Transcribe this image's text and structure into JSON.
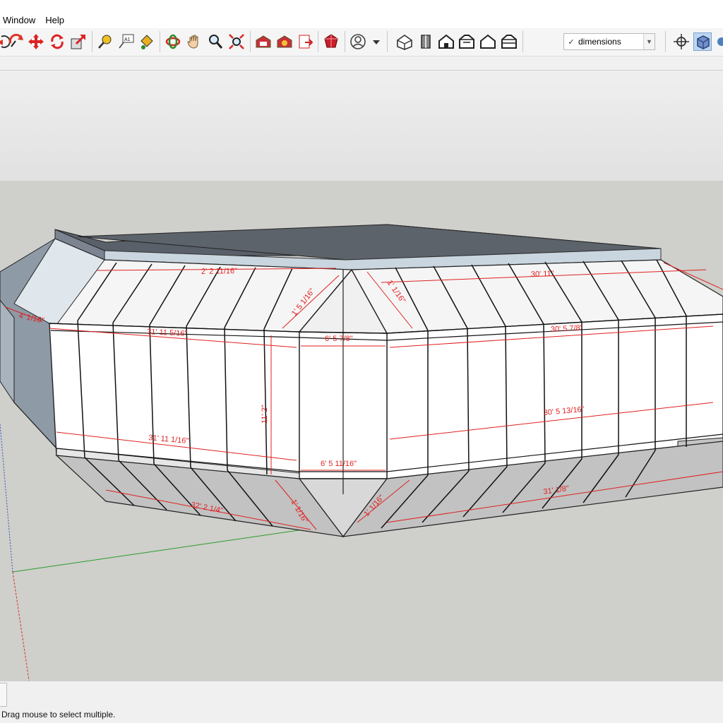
{
  "menu": {
    "items": [
      {
        "label": "Window"
      },
      {
        "label": "Help"
      }
    ]
  },
  "toolbar": {
    "icons": [
      "orbit-partial-icon",
      "rotate-icon",
      "move-icon",
      "follow-me-icon",
      "push-pull-icon",
      "tape-measure-icon",
      "text-label-icon",
      "paint-bucket-icon",
      "orbit-icon",
      "pan-hand-icon",
      "zoom-icon",
      "zoom-extents-icon",
      "warehouse-icon",
      "extension-warehouse-icon",
      "send-to-layout-icon",
      "extension-manager-icon",
      "account-icon",
      "iso-view-icon",
      "top-view-icon",
      "front-view-icon",
      "right-view-icon",
      "back-view-icon",
      "left-view-icon",
      "section-plane-icon",
      "section-display-icon",
      "section-cut-icon"
    ],
    "scene_select": {
      "check": "✓",
      "value": "dimensions"
    }
  },
  "viewport": {
    "dimensions": [
      {
        "text": "2' 2 11/16\""
      },
      {
        "text": "30' 11\""
      },
      {
        "text": "1' 5 1/16\""
      },
      {
        "text": "1' 1/16\""
      },
      {
        "text": "4' 1/16\""
      },
      {
        "text": "31' 11 5/16\""
      },
      {
        "text": "6' 5 7/8\""
      },
      {
        "text": "30' 5 7/8\""
      },
      {
        "text": "11' 2\""
      },
      {
        "text": "31' 11 1/16\""
      },
      {
        "text": "30' 5 13/16\""
      },
      {
        "text": "6' 5 11/16\""
      },
      {
        "text": "32' 2 1/4\""
      },
      {
        "text": "1' 1/16\""
      },
      {
        "text": "1' 1/16\""
      },
      {
        "text": "31' 1/8\""
      }
    ]
  },
  "status": {
    "message": "Drag mouse to select multiple."
  },
  "colors": {
    "dimension": "#e02020",
    "axis_green": "#2a9d2a",
    "axis_red": "#d83030",
    "wall": "#ffffff",
    "shadow_face": "#c4c4c4",
    "roof": "#5f6468"
  }
}
